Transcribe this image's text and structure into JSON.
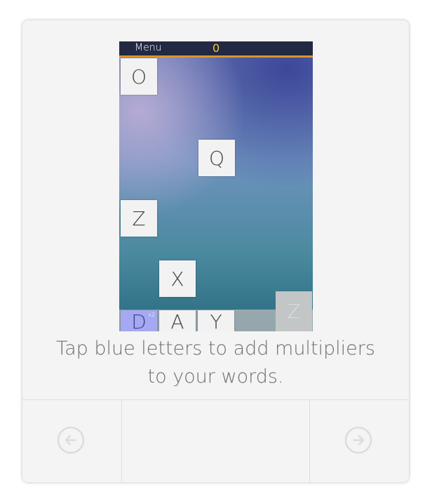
{
  "game": {
    "menu_label": "Menu",
    "score": "0",
    "board_tiles": [
      "O",
      "Q",
      "Z",
      "X"
    ],
    "word_tiles": [
      {
        "letter": "D",
        "multiplier": "x2",
        "style": "blue"
      },
      {
        "letter": "A"
      },
      {
        "letter": "Y"
      }
    ],
    "next_tile": "Z"
  },
  "tutorial": {
    "caption_line1": "Tap blue letters to add multipliers",
    "caption_line2": "to your words."
  },
  "navigation": {
    "prev_icon": "arrow-left-circle-icon",
    "next_icon": "arrow-right-circle-icon"
  },
  "colors": {
    "topbar": "#232843",
    "topbar_accent": "#d8952a",
    "score": "#f0c640",
    "blue_tile": "#a5a9f1",
    "tile": "#f2f2f2"
  }
}
